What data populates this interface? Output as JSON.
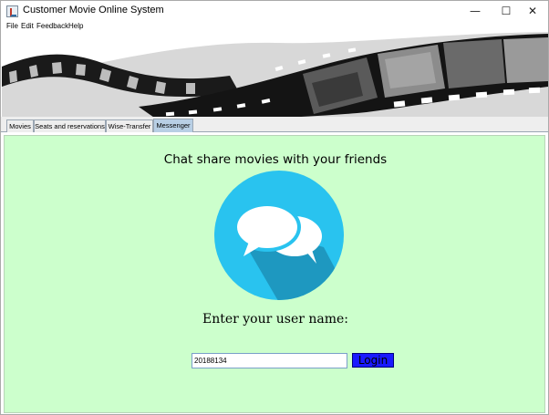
{
  "window": {
    "title": "Customer Movie Online System",
    "controls": {
      "minimize": "—",
      "maximize": "☐",
      "close": "✕"
    }
  },
  "menubar": {
    "items": [
      {
        "label": "File"
      },
      {
        "label": "Edit"
      },
      {
        "label": "Feedback"
      },
      {
        "label": "Help"
      }
    ]
  },
  "tabs": [
    {
      "label": "Movies",
      "active": false
    },
    {
      "label": "Seats and reservations",
      "active": false
    },
    {
      "label": "Wise-Transfer",
      "active": false
    },
    {
      "label": "Messenger",
      "active": true
    }
  ],
  "messenger": {
    "heading": "Chat share movies with your friends",
    "icon": "chat-bubbles-icon",
    "username_label": "Enter your user name:",
    "username_value": "20188134",
    "login_label": "Login"
  },
  "colors": {
    "content_background": "#ccffcc",
    "icon_circle": "#29c3ef",
    "icon_shadow": "#1e98c0",
    "login_button": "#1a1aff",
    "active_tab": "#b8cfe5"
  }
}
